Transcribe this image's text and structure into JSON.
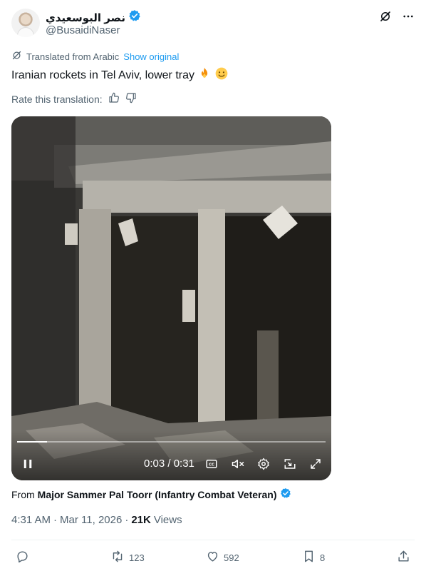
{
  "author": {
    "display_name": "نصر البوسعيدي",
    "handle": "@BusaidiNaser",
    "verified": true
  },
  "translation": {
    "label": "Translated from Arabic",
    "show_original": "Show original",
    "rate_label": "Rate this translation:"
  },
  "tweet": {
    "text": "Iranian rockets in Tel Aviv, lower tray",
    "emojis": [
      "fire",
      "slightly-smiling-face"
    ]
  },
  "video": {
    "current_time": "0:03",
    "duration": "0:31",
    "time_display": "0:03 / 0:31",
    "progress_fraction": 0.097,
    "state": "playing",
    "muted": true
  },
  "attribution": {
    "prefix": "From",
    "source": "Major Sammer Pal Toorr (Infantry Combat Veteran)"
  },
  "meta": {
    "time": "4:31 AM",
    "date": "Mar 11, 2026",
    "views_count": "21K",
    "views_label": "Views"
  },
  "actions": {
    "replies": "",
    "reposts": "123",
    "likes": "592",
    "bookmarks": "8"
  },
  "colors": {
    "accent": "#1d9bf0",
    "secondary_text": "#536471",
    "primary_text": "#0f1419"
  }
}
